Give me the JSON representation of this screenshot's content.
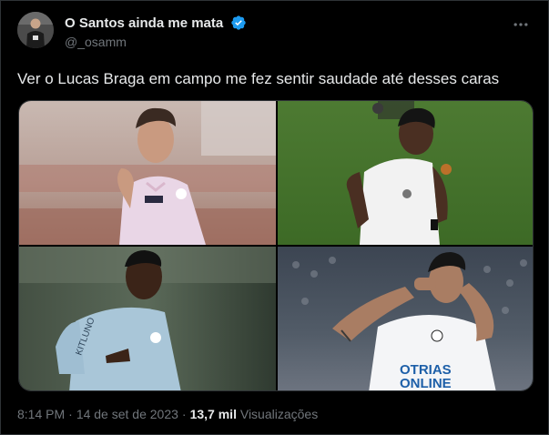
{
  "author": {
    "display_name": "O Santos ainda me mata",
    "handle": "@_osamm",
    "verified": true,
    "verified_color": "#1d9bf0",
    "avatar_icon": "player-avatar"
  },
  "more_icon": "more-options-icon",
  "tweet": {
    "text": "Ver o Lucas Braga em campo me fez sentir saudade até desses caras"
  },
  "media": {
    "photos": [
      {
        "name": "photo-player-pink-kit"
      },
      {
        "name": "photo-player-white-kit-field"
      },
      {
        "name": "photo-player-blue-training-kit"
      },
      {
        "name": "photo-player-white-kit-celebrating"
      }
    ],
    "sponsor_text": [
      "OTRIAS",
      "ONLINE"
    ]
  },
  "meta": {
    "time": "8:14 PM",
    "separator": "·",
    "date": "14 de set de 2023",
    "views_count": "13,7 mil",
    "views_label": "Visualizações"
  },
  "colors": {
    "background": "#000000",
    "text_primary": "#e7e9ea",
    "text_secondary": "#71767b",
    "border": "#2f3336"
  }
}
